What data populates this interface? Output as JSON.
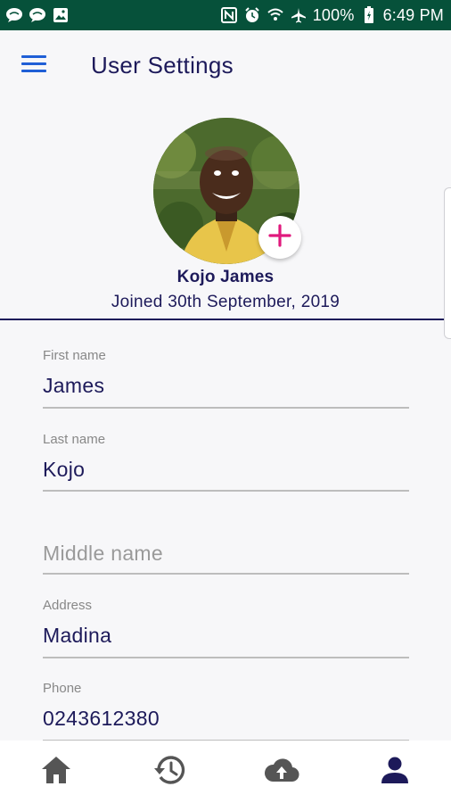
{
  "status_bar": {
    "battery": "100%",
    "time": "6:49 PM",
    "icons": [
      "chat-icon",
      "chat-icon",
      "image-icon",
      "nfc-icon",
      "alarm-icon",
      "wifi-icon",
      "airplane-icon",
      "battery-icon"
    ]
  },
  "app_bar": {
    "title": "User Settings",
    "menu_icon": "menu-icon"
  },
  "profile": {
    "name": "Kojo  James",
    "joined": "Joined 30th September, 2019",
    "add_photo_icon": "plus-icon"
  },
  "form": {
    "first_name": {
      "label": "First name",
      "value": "James"
    },
    "last_name": {
      "label": "Last name",
      "value": "Kojo"
    },
    "middle_name": {
      "placeholder": "Middle name"
    },
    "address": {
      "label": "Address",
      "value": "Madina"
    },
    "phone": {
      "label": "Phone",
      "value": "0243612380"
    }
  },
  "bottom_nav": {
    "items": [
      {
        "icon": "home-icon",
        "active": false
      },
      {
        "icon": "history-icon",
        "active": false
      },
      {
        "icon": "cloud-upload-icon",
        "active": false
      },
      {
        "icon": "person-icon",
        "active": true
      }
    ],
    "active_color": "#1d1a5a",
    "inactive_color": "#555555"
  },
  "colors": {
    "status_bar": "#06513a",
    "primary_text": "#1d1a5a",
    "accent_plus": "#e0197d",
    "menu_blue": "#1f5fd6"
  }
}
